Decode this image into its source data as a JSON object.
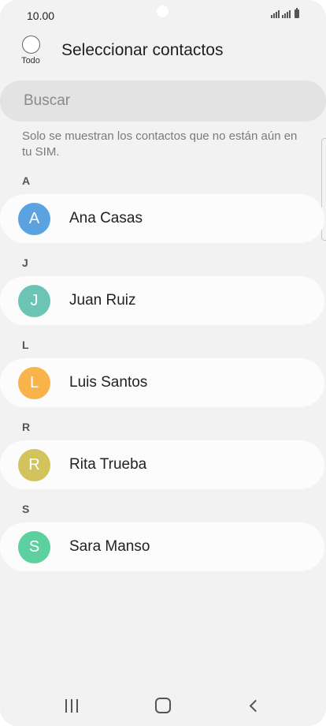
{
  "status_bar": {
    "time": "10.00"
  },
  "header": {
    "select_all_label": "Todo",
    "title": "Seleccionar contactos"
  },
  "search": {
    "placeholder": "Buscar"
  },
  "info_text": "Solo se muestran los contactos que no están aún en tu SIM.",
  "sections": [
    {
      "letter": "A",
      "contact": {
        "initial": "A",
        "name": "Ana Casas",
        "avatar_color": "#5aa3e0"
      }
    },
    {
      "letter": "J",
      "contact": {
        "initial": "J",
        "name": "Juan Ruiz",
        "avatar_color": "#6cc4b5"
      }
    },
    {
      "letter": "L",
      "contact": {
        "initial": "L",
        "name": "Luis Santos",
        "avatar_color": "#f8b34a"
      }
    },
    {
      "letter": "R",
      "contact": {
        "initial": "R",
        "name": "Rita Trueba",
        "avatar_color": "#d3c35c"
      }
    },
    {
      "letter": "S",
      "contact": {
        "initial": "S",
        "name": "Sara Manso",
        "avatar_color": "#5ed0a0"
      }
    }
  ],
  "nav_bar": {
    "icons": [
      "recents-icon",
      "home-icon",
      "back-icon"
    ]
  }
}
